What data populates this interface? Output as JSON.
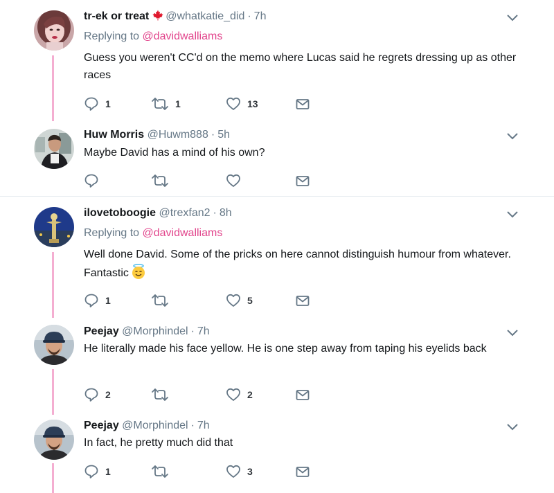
{
  "tweets": [
    {
      "name": "tr-ek or treat",
      "handle": "@whatkatie_did",
      "separator": "·",
      "time": "7h",
      "replying_prefix": "Replying to ",
      "replying_to": "@davidwalliams",
      "text": "Guess you weren't CC'd on the memo where Lucas said he regrets dressing up as other races",
      "counts": {
        "reply": "1",
        "retweet": "1",
        "like": "13"
      }
    },
    {
      "name": "Huw Morris",
      "handle": "@Huwm888",
      "separator": "·",
      "time": "5h",
      "text": "Maybe David has a mind of his own?",
      "counts": {
        "reply": "",
        "retweet": "",
        "like": ""
      }
    },
    {
      "name": "ilovetoboogie",
      "handle": "@trexfan2",
      "separator": "·",
      "time": "8h",
      "replying_prefix": "Replying to ",
      "replying_to": "@davidwalliams",
      "text": "Well done David. Some of the pricks on here cannot distinguish humour from whatever. Fantastic",
      "counts": {
        "reply": "1",
        "retweet": "",
        "like": "5"
      }
    },
    {
      "name": "Peejay",
      "handle": "@Morphindel",
      "separator": "·",
      "time": "7h",
      "text": "He literally made his face yellow. He is one step away from taping his eyelids back",
      "counts": {
        "reply": "2",
        "retweet": "",
        "like": "2"
      }
    },
    {
      "name": "Peejay",
      "handle": "@Morphindel",
      "separator": "·",
      "time": "7h",
      "text": "In fact, he pretty much did that",
      "counts": {
        "reply": "1",
        "retweet": "",
        "like": "3"
      }
    }
  ],
  "colors": {
    "mention": "#e2458c",
    "thread_line": "#f4aed1",
    "icon": "#657786",
    "divider": "#e6ecf0"
  },
  "icons": {
    "reply": "reply-icon",
    "retweet": "retweet-icon",
    "like": "heart-icon",
    "message": "envelope-icon",
    "more": "chevron-down-icon",
    "flag": "maple-leaf-icon",
    "emoji": "smiling-face-with-halo-emoji"
  }
}
